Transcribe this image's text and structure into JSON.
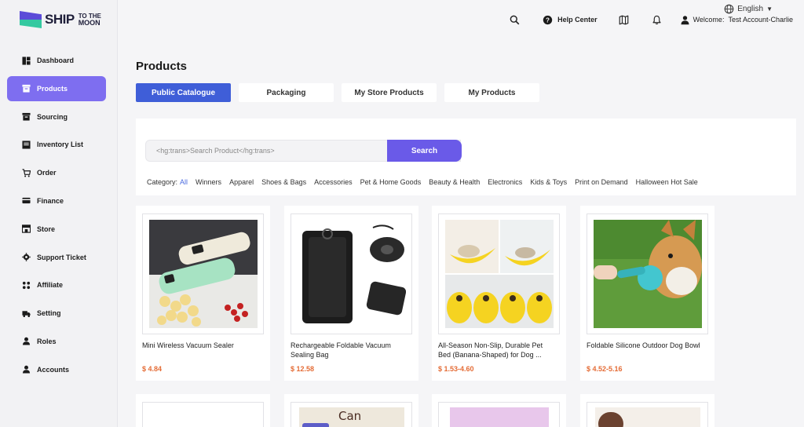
{
  "brand": {
    "name": "SHIP",
    "sub_top": "TO THE",
    "sub_bottom": "MOON"
  },
  "sidebar": {
    "items": [
      {
        "label": "Dashboard",
        "icon": "dashboard-icon"
      },
      {
        "label": "Products",
        "icon": "box-icon",
        "active": true
      },
      {
        "label": "Sourcing",
        "icon": "archive-icon"
      },
      {
        "label": "Inventory List",
        "icon": "inventory-icon"
      },
      {
        "label": "Order",
        "icon": "cart-icon"
      },
      {
        "label": "Finance",
        "icon": "card-icon"
      },
      {
        "label": "Store",
        "icon": "store-icon"
      },
      {
        "label": "Support Ticket",
        "icon": "gear-icon"
      },
      {
        "label": "Affiliate",
        "icon": "affiliate-icon"
      },
      {
        "label": "Setting",
        "icon": "truck-icon"
      },
      {
        "label": "Roles",
        "icon": "user-icon"
      },
      {
        "label": "Accounts",
        "icon": "user-icon"
      }
    ]
  },
  "topbar": {
    "language": "English",
    "help_label": "Help Center",
    "welcome_prefix": "Welcome:",
    "welcome_user": "Test Account-Charlie"
  },
  "page": {
    "title": "Products"
  },
  "tabs": [
    {
      "label": "Public Catalogue",
      "active": true
    },
    {
      "label": "Packaging"
    },
    {
      "label": "My Store Products"
    },
    {
      "label": "My Products"
    }
  ],
  "search": {
    "placeholder": "<hg:trans>Search Product</hg:trans>",
    "button_label": "Search"
  },
  "categories": {
    "label": "Category:",
    "items": [
      "All",
      "Winners",
      "Apparel",
      "Shoes & Bags",
      "Accessories",
      "Pet & Home Goods",
      "Beauty & Health",
      "Electronics",
      "Kids & Toys",
      "Print on Demand",
      "Halloween Hot Sale"
    ]
  },
  "products": [
    {
      "name": "Mini Wireless Vacuum Sealer",
      "price": "$ 4.84"
    },
    {
      "name": "Rechargeable Foldable Vacuum Sealing Bag",
      "price": "$ 12.58"
    },
    {
      "name": "All-Season Non-Slip, Durable Pet Bed (Banana-Shaped) for Dog ...",
      "price": "$ 1.53-4.60"
    },
    {
      "name": "Foldable Silicone Outdoor Dog Bowl",
      "price": "$ 4.52-5.16"
    }
  ],
  "next_row": {
    "can_opener_text": "Can opener"
  },
  "colors": {
    "accent": "#6a5ae8",
    "tab_active": "#3f5ed8",
    "price": "#e46c36",
    "category_active": "#4b6be0"
  }
}
